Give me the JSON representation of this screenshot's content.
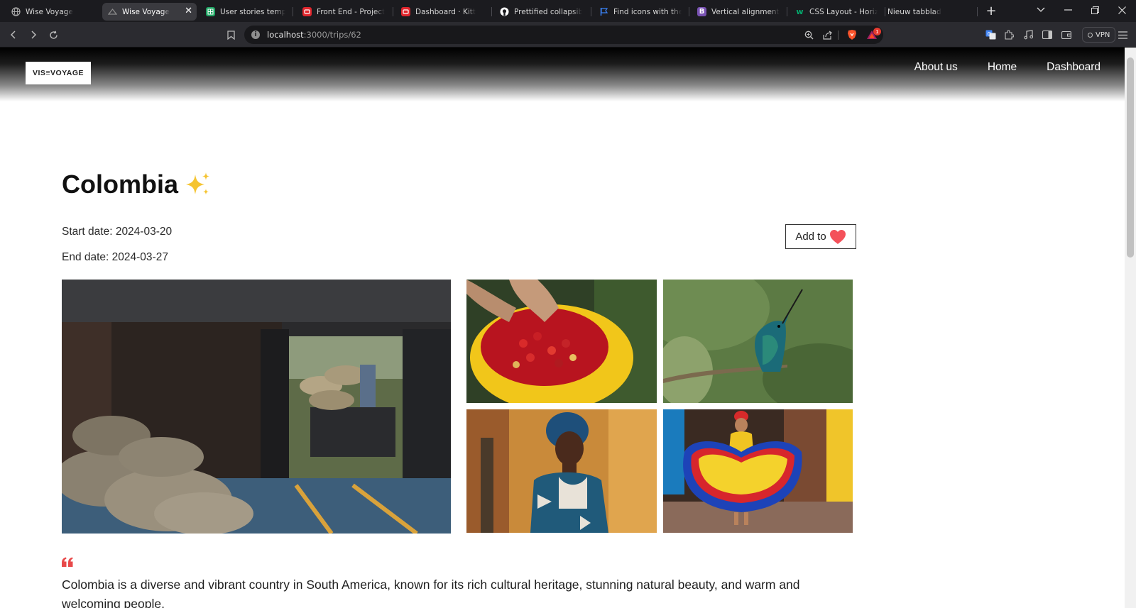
{
  "browser": {
    "tabs": [
      {
        "title": "Wise Voyage",
        "active": false,
        "favicon": "globe-icon",
        "favicon_color": "#b0b0b0"
      },
      {
        "title": "Wise Voyage",
        "active": true,
        "favicon": "wise-voyage-icon",
        "favicon_color": "#8c8c8c"
      },
      {
        "title": "User stories template",
        "active": false,
        "favicon": "sheets-icon",
        "favicon_color": "#1fa463"
      },
      {
        "title": "Front End - Projects · K",
        "active": false,
        "favicon": "kitt-icon",
        "favicon_color": "#e0262d"
      },
      {
        "title": "Dashboard · Kitt",
        "active": false,
        "favicon": "kitt-icon",
        "favicon_color": "#e0262d"
      },
      {
        "title": "Prettified collapsible b",
        "active": false,
        "favicon": "github-icon",
        "favicon_color": "#ffffff"
      },
      {
        "title": "Find icons with the Per",
        "active": false,
        "favicon": "flag-icon",
        "favicon_color": "#3b82f6"
      },
      {
        "title": "Vertical alignment · Bo",
        "active": false,
        "favicon": "bootstrap-icon",
        "favicon_color": "#7952b3"
      },
      {
        "title": "CSS Layout - Horizont",
        "active": false,
        "favicon": "w3schools-icon",
        "favicon_color": "#04aa6d"
      },
      {
        "title": "Nieuw tabblad",
        "active": false,
        "favicon": "",
        "favicon_color": ""
      }
    ],
    "url_host": "localhost",
    "url_path": ":3000/trips/62",
    "brave_badge": "1",
    "vpn_label": "VPN"
  },
  "site": {
    "logo_text": "VIS≡VOYAGE",
    "nav": [
      {
        "label": "About us"
      },
      {
        "label": "Home"
      },
      {
        "label": "Dashboard"
      }
    ]
  },
  "trip": {
    "title": "Colombia",
    "start_date": "Start date: 2024-03-20",
    "end_date": "End date: 2024-03-27",
    "favorite_button": "Add to",
    "photos": [
      {
        "subject": "coffee-warehouse"
      },
      {
        "subject": "coffee-cherries"
      },
      {
        "subject": "hummingbird"
      },
      {
        "subject": "woman-in-headwrap"
      },
      {
        "subject": "dancer-in-dress"
      }
    ],
    "description": "Colombia is a diverse and vibrant country in South America, known for its rich cultural heritage, stunning natural beauty, and warm and welcoming people."
  },
  "colors": {
    "accent_red": "#e8494a",
    "heart": "#f4515a",
    "sparkle": "#f5c431"
  }
}
